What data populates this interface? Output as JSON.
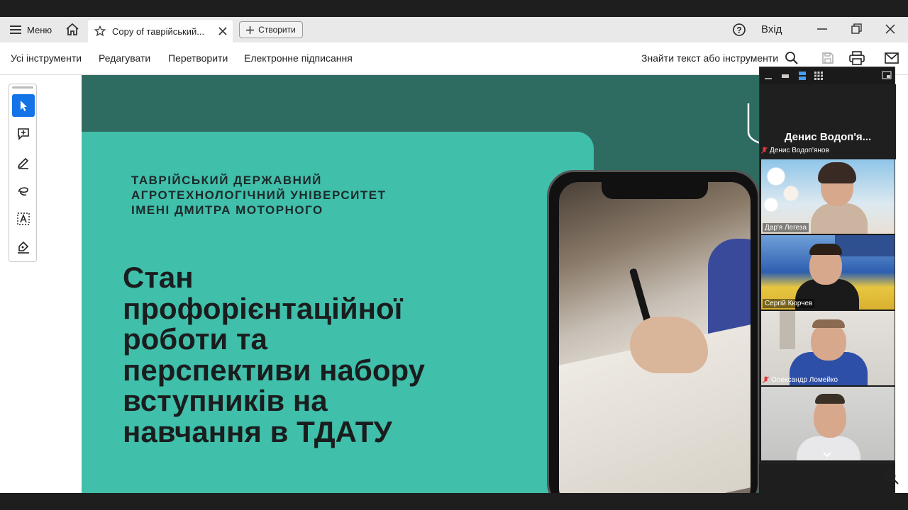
{
  "tabbar": {
    "menu_label": "Меню",
    "tab_title": "Copy of таврійський...",
    "create_label": "Створити",
    "signin_label": "Вхід"
  },
  "toolbar": {
    "all_tools": "Усі інструменти",
    "edit": "Редагувати",
    "convert": "Перетворити",
    "esign": "Електронне підписання",
    "find": "Знайти текст або інструменти"
  },
  "slide": {
    "university_lines": [
      "ТАВРІЙСЬКИЙ ДЕРЖАВНИЙ",
      "АГРОТЕХНОЛОГІЧНИЙ УНІВЕРСИТЕТ",
      "ІМЕНІ ДМИТРА МОТОРНОГО"
    ],
    "title_lines": [
      "Стан",
      "профорієнтаційної",
      "роботи та",
      "перспективи набору",
      "вступників на",
      "навчання в ТДАТУ"
    ]
  },
  "video": {
    "active_speaker": "Денис Водоп'я...",
    "participants": [
      {
        "name": "Денис Водоп'янов",
        "muted": true
      },
      {
        "name": "Дар'я Легеза",
        "muted": false
      },
      {
        "name": "Сергій Кюрчев",
        "muted": false
      },
      {
        "name": "Олександр Ломейко",
        "muted": true
      },
      {
        "name": "",
        "muted": false
      }
    ]
  },
  "colors": {
    "slide_dark": "#2e6b61",
    "slide_teal": "#40bfab",
    "accent_blue": "#1473e6",
    "mute_red": "#e03c3c"
  }
}
